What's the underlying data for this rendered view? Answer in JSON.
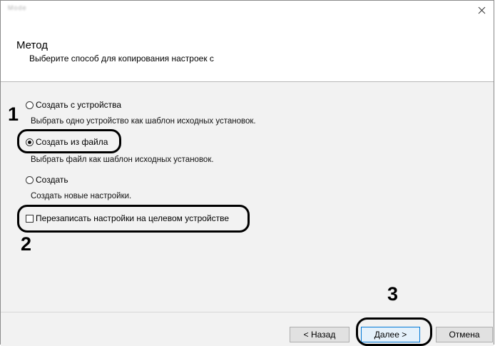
{
  "window": {
    "title": "Mode Set",
    "close_glyph": "✕"
  },
  "header": {
    "title": "Метод",
    "subtitle": "Выберите способ для копирования настроек с"
  },
  "options": [
    {
      "label": "Создать с устройства",
      "description": "Выбрать одно устройство как шаблон исходных установок.",
      "checked": false
    },
    {
      "label": "Создать из файла",
      "description": "Выбрать файл как шаблон исходных установок.",
      "checked": true
    },
    {
      "label": "Создать",
      "description": "Создать новые настройки.",
      "checked": false
    }
  ],
  "overwrite_checkbox": {
    "label": "Перезаписать настройки на целевом устройстве",
    "checked": false
  },
  "steps": [
    "1",
    "2",
    "3"
  ],
  "buttons": {
    "back": "< Назад",
    "next": "Далее >",
    "cancel": "Отмена"
  },
  "colors": {
    "focus_border": "#0078d7",
    "annotation": "#000000"
  }
}
